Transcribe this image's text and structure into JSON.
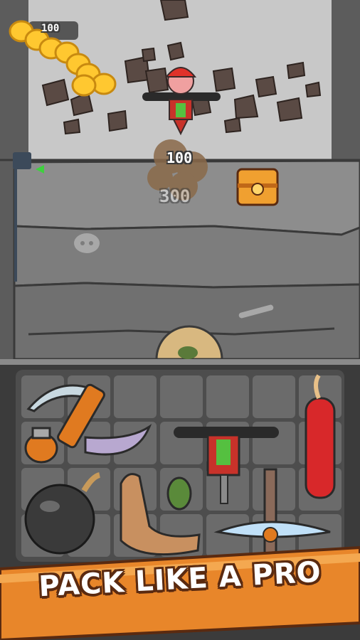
{
  "hud": {
    "coin_count": "100",
    "coin_icon": "coin-stack-icon"
  },
  "mine": {
    "damage_popup": "100",
    "damage_popup_faded": "300",
    "treasure": "treasure-chest-icon",
    "depth_marker": "depth-arrow-icon"
  },
  "inventory": {
    "grid_columns": 7,
    "grid_rows": 4,
    "items": [
      "pickaxe-scythe-icon",
      "grenade-icon",
      "drill-hammer-icon",
      "dynamite-icon",
      "bomb-icon",
      "boomerang-icon",
      "small-grenade-icon",
      "ice-pickaxe-icon"
    ]
  },
  "banner": {
    "text": "PACK LIKE A PRO"
  },
  "colors": {
    "rock": "#8a8a8a",
    "rock_dark": "#5e5e5e",
    "inventory_bg": "#3b3b3b",
    "slot": "#6b6b6b",
    "banner_orange": "#e8862a",
    "banner_outline": "#5a2a10"
  }
}
